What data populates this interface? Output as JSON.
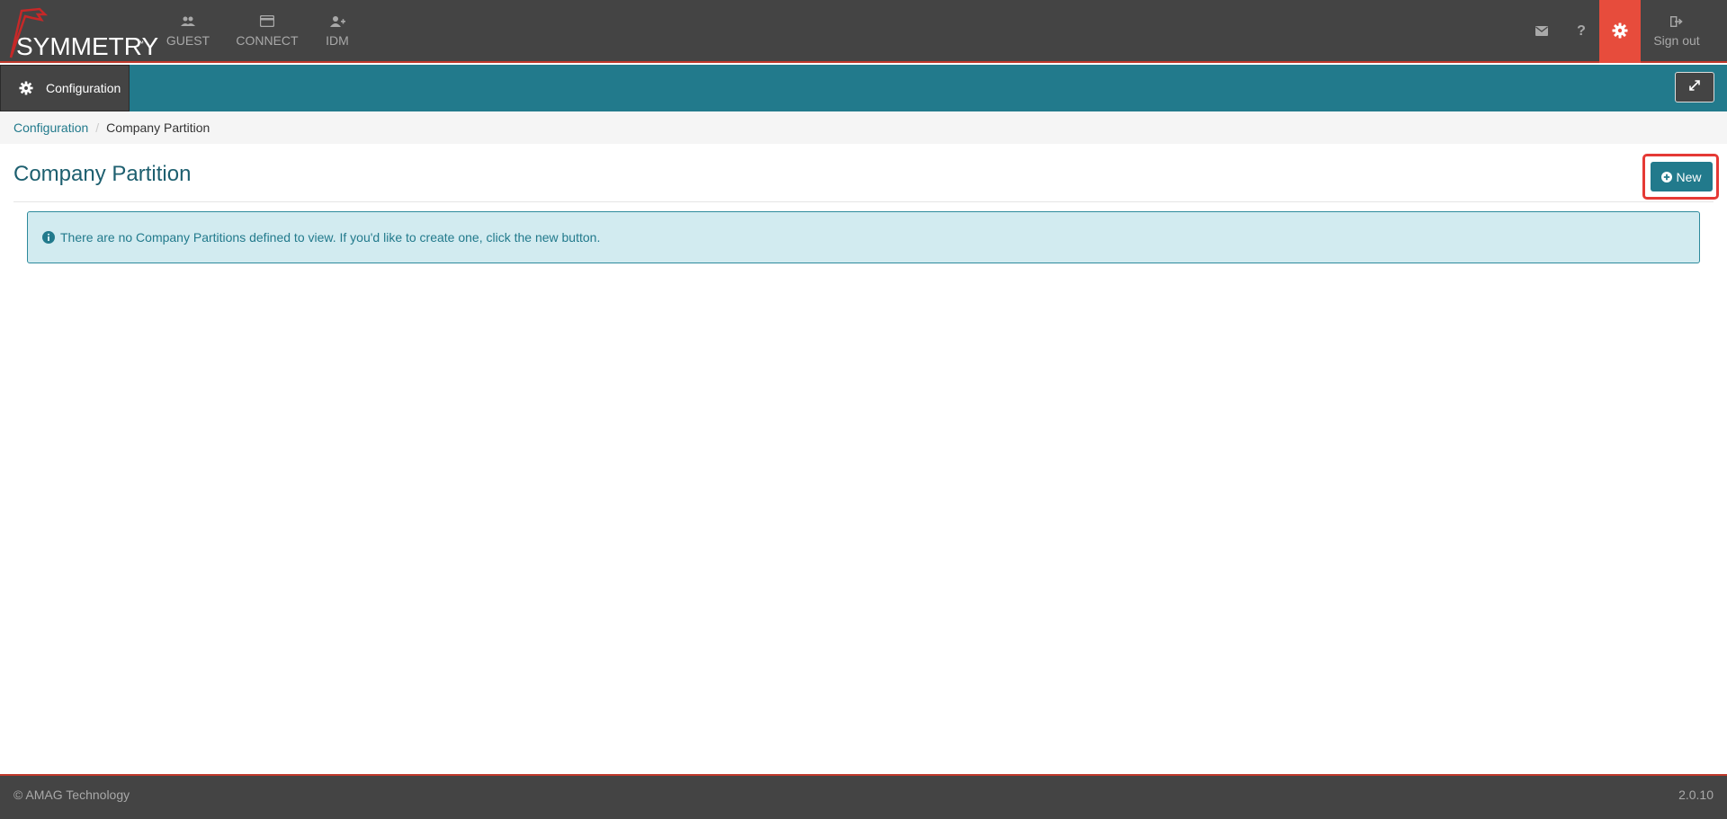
{
  "brand": {
    "name": "SYMMETRY",
    "trademark": "™"
  },
  "nav": {
    "items": [
      {
        "label": "GUEST",
        "icon": "users-icon"
      },
      {
        "label": "CONNECT",
        "icon": "credit-card-icon"
      },
      {
        "label": "IDM",
        "icon": "user-plus-icon"
      }
    ],
    "right": {
      "mail_icon": "envelope-icon",
      "help_label": "?",
      "settings_icon": "gear-icon",
      "signout_label": "Sign out",
      "signout_icon": "sign-out-icon"
    }
  },
  "subbar": {
    "tab_label": "Configuration",
    "tab_icon": "gear-icon",
    "expand_icon": "expand-icon"
  },
  "breadcrumb": {
    "items": [
      {
        "label": "Configuration"
      },
      {
        "label": "Company Partition"
      }
    ],
    "separator": "/"
  },
  "page": {
    "title": "Company Partition",
    "new_button_label": "New",
    "info_message": "There are no Company Partitions defined to view. If you'd like to create one, click the new button."
  },
  "footer": {
    "copyright": "© AMAG Technology",
    "version": "2.0.10"
  },
  "colors": {
    "dark": "#444444",
    "teal": "#227a8c",
    "accent_red": "#e74c3c",
    "alert_bg": "#d2ebf0",
    "highlight": "#e53935"
  }
}
